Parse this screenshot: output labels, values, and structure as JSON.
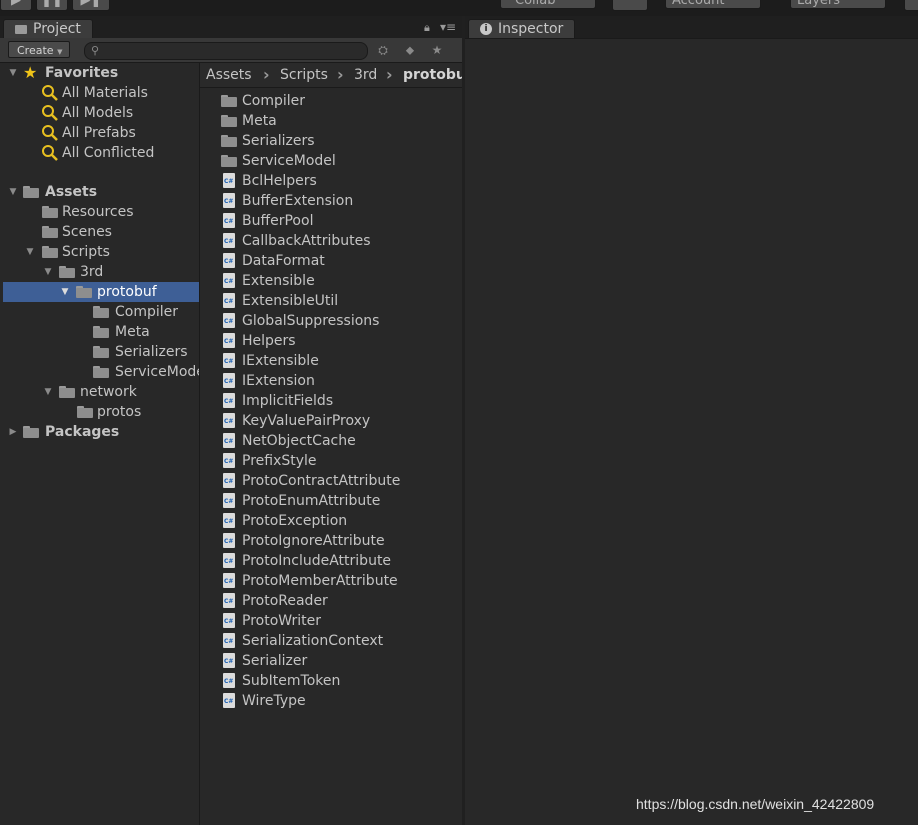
{
  "topbar": {
    "collab": "Collab",
    "account": "Account",
    "layers": "Layers"
  },
  "project": {
    "tab_label": "Project",
    "create_label": "Create",
    "tree": {
      "favorites": {
        "label": "Favorites",
        "items": [
          "All Materials",
          "All Models",
          "All Prefabs",
          "All Conflicted"
        ]
      },
      "assets": {
        "label": "Assets"
      },
      "resources": "Resources",
      "scenes": "Scenes",
      "scripts": "Scripts",
      "third": "3rd",
      "protobuf": "protobuf",
      "compiler": "Compiler",
      "meta": "Meta",
      "serializers": "Serializers",
      "servicemodel": "ServiceModel",
      "network": "network",
      "protos": "protos",
      "packages": "Packages"
    },
    "breadcrumb": [
      "Assets",
      "Scripts",
      "3rd",
      "protobuf"
    ],
    "folders": [
      "Compiler",
      "Meta",
      "Serializers",
      "ServiceModel"
    ],
    "files": [
      "BclHelpers",
      "BufferExtension",
      "BufferPool",
      "CallbackAttributes",
      "DataFormat",
      "Extensible",
      "ExtensibleUtil",
      "GlobalSuppressions",
      "Helpers",
      "IExtensible",
      "IExtension",
      "ImplicitFields",
      "KeyValuePairProxy",
      "NetObjectCache",
      "PrefixStyle",
      "ProtoContractAttribute",
      "ProtoEnumAttribute",
      "ProtoException",
      "ProtoIgnoreAttribute",
      "ProtoIncludeAttribute",
      "ProtoMemberAttribute",
      "ProtoReader",
      "ProtoWriter",
      "SerializationContext",
      "Serializer",
      "SubItemToken",
      "WireType"
    ]
  },
  "inspector": {
    "tab_label": "Inspector"
  },
  "watermark": "https://blog.csdn.net/weixin_42422809",
  "colors": {
    "selection": "#3e5f96",
    "star": "#f0c419",
    "magnifier": "#e8c020"
  }
}
